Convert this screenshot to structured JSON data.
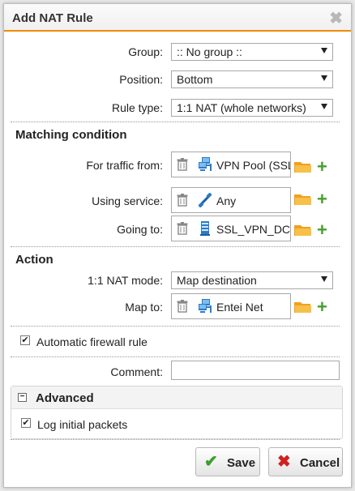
{
  "dialog": {
    "title": "Add NAT Rule",
    "close_icon": "close-icon"
  },
  "fields": {
    "group_label": "Group:",
    "group_value": ":: No group ::",
    "position_label": "Position:",
    "position_value": "Bottom",
    "rule_type_label": "Rule type:",
    "rule_type_value": "1:1 NAT (whole networks)"
  },
  "matching": {
    "title": "Matching condition",
    "traffic_from_label": "For traffic from:",
    "traffic_from_value": "VPN Pool (SSL)",
    "traffic_from_icon": "network-icon",
    "service_label": "Using service:",
    "service_value": "Any",
    "service_icon": "service-any-icon",
    "going_to_label": "Going to:",
    "going_to_value": "SSL_VPN_DC",
    "going_to_icon": "host-icon"
  },
  "action": {
    "title": "Action",
    "nat_mode_label": "1:1 NAT mode:",
    "nat_mode_value": "Map destination",
    "map_to_label": "Map to:",
    "map_to_value": "Entei Net",
    "map_to_icon": "network-icon"
  },
  "options": {
    "auto_fw_label": "Automatic firewall rule",
    "auto_fw_checked": true,
    "comment_label": "Comment:",
    "comment_value": ""
  },
  "advanced": {
    "title": "Advanced",
    "log_label": "Log initial packets",
    "log_checked": true
  },
  "buttons": {
    "save": "Save",
    "cancel": "Cancel"
  },
  "colors": {
    "accent": "#f08a00",
    "add_green": "#44a030",
    "save_green": "#3aa02a",
    "cancel_red": "#d02020",
    "folder_orange": "#f0a020",
    "icon_blue": "#2a7bc8"
  }
}
